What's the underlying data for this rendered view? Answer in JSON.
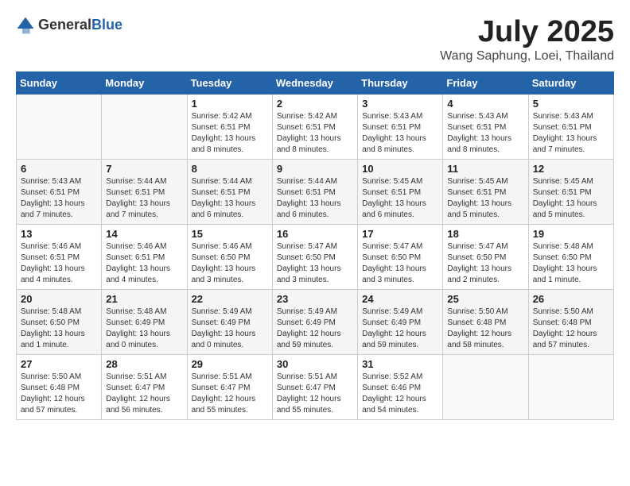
{
  "logo": {
    "general": "General",
    "blue": "Blue"
  },
  "title": "July 2025",
  "location": "Wang Saphung, Loei, Thailand",
  "days_of_week": [
    "Sunday",
    "Monday",
    "Tuesday",
    "Wednesday",
    "Thursday",
    "Friday",
    "Saturday"
  ],
  "weeks": [
    [
      {
        "day": "",
        "info": ""
      },
      {
        "day": "",
        "info": ""
      },
      {
        "day": "1",
        "info": "Sunrise: 5:42 AM\nSunset: 6:51 PM\nDaylight: 13 hours and 8 minutes."
      },
      {
        "day": "2",
        "info": "Sunrise: 5:42 AM\nSunset: 6:51 PM\nDaylight: 13 hours and 8 minutes."
      },
      {
        "day": "3",
        "info": "Sunrise: 5:43 AM\nSunset: 6:51 PM\nDaylight: 13 hours and 8 minutes."
      },
      {
        "day": "4",
        "info": "Sunrise: 5:43 AM\nSunset: 6:51 PM\nDaylight: 13 hours and 8 minutes."
      },
      {
        "day": "5",
        "info": "Sunrise: 5:43 AM\nSunset: 6:51 PM\nDaylight: 13 hours and 7 minutes."
      }
    ],
    [
      {
        "day": "6",
        "info": "Sunrise: 5:43 AM\nSunset: 6:51 PM\nDaylight: 13 hours and 7 minutes."
      },
      {
        "day": "7",
        "info": "Sunrise: 5:44 AM\nSunset: 6:51 PM\nDaylight: 13 hours and 7 minutes."
      },
      {
        "day": "8",
        "info": "Sunrise: 5:44 AM\nSunset: 6:51 PM\nDaylight: 13 hours and 6 minutes."
      },
      {
        "day": "9",
        "info": "Sunrise: 5:44 AM\nSunset: 6:51 PM\nDaylight: 13 hours and 6 minutes."
      },
      {
        "day": "10",
        "info": "Sunrise: 5:45 AM\nSunset: 6:51 PM\nDaylight: 13 hours and 6 minutes."
      },
      {
        "day": "11",
        "info": "Sunrise: 5:45 AM\nSunset: 6:51 PM\nDaylight: 13 hours and 5 minutes."
      },
      {
        "day": "12",
        "info": "Sunrise: 5:45 AM\nSunset: 6:51 PM\nDaylight: 13 hours and 5 minutes."
      }
    ],
    [
      {
        "day": "13",
        "info": "Sunrise: 5:46 AM\nSunset: 6:51 PM\nDaylight: 13 hours and 4 minutes."
      },
      {
        "day": "14",
        "info": "Sunrise: 5:46 AM\nSunset: 6:51 PM\nDaylight: 13 hours and 4 minutes."
      },
      {
        "day": "15",
        "info": "Sunrise: 5:46 AM\nSunset: 6:50 PM\nDaylight: 13 hours and 3 minutes."
      },
      {
        "day": "16",
        "info": "Sunrise: 5:47 AM\nSunset: 6:50 PM\nDaylight: 13 hours and 3 minutes."
      },
      {
        "day": "17",
        "info": "Sunrise: 5:47 AM\nSunset: 6:50 PM\nDaylight: 13 hours and 3 minutes."
      },
      {
        "day": "18",
        "info": "Sunrise: 5:47 AM\nSunset: 6:50 PM\nDaylight: 13 hours and 2 minutes."
      },
      {
        "day": "19",
        "info": "Sunrise: 5:48 AM\nSunset: 6:50 PM\nDaylight: 13 hours and 1 minute."
      }
    ],
    [
      {
        "day": "20",
        "info": "Sunrise: 5:48 AM\nSunset: 6:50 PM\nDaylight: 13 hours and 1 minute."
      },
      {
        "day": "21",
        "info": "Sunrise: 5:48 AM\nSunset: 6:49 PM\nDaylight: 13 hours and 0 minutes."
      },
      {
        "day": "22",
        "info": "Sunrise: 5:49 AM\nSunset: 6:49 PM\nDaylight: 13 hours and 0 minutes."
      },
      {
        "day": "23",
        "info": "Sunrise: 5:49 AM\nSunset: 6:49 PM\nDaylight: 12 hours and 59 minutes."
      },
      {
        "day": "24",
        "info": "Sunrise: 5:49 AM\nSunset: 6:49 PM\nDaylight: 12 hours and 59 minutes."
      },
      {
        "day": "25",
        "info": "Sunrise: 5:50 AM\nSunset: 6:48 PM\nDaylight: 12 hours and 58 minutes."
      },
      {
        "day": "26",
        "info": "Sunrise: 5:50 AM\nSunset: 6:48 PM\nDaylight: 12 hours and 57 minutes."
      }
    ],
    [
      {
        "day": "27",
        "info": "Sunrise: 5:50 AM\nSunset: 6:48 PM\nDaylight: 12 hours and 57 minutes."
      },
      {
        "day": "28",
        "info": "Sunrise: 5:51 AM\nSunset: 6:47 PM\nDaylight: 12 hours and 56 minutes."
      },
      {
        "day": "29",
        "info": "Sunrise: 5:51 AM\nSunset: 6:47 PM\nDaylight: 12 hours and 55 minutes."
      },
      {
        "day": "30",
        "info": "Sunrise: 5:51 AM\nSunset: 6:47 PM\nDaylight: 12 hours and 55 minutes."
      },
      {
        "day": "31",
        "info": "Sunrise: 5:52 AM\nSunset: 6:46 PM\nDaylight: 12 hours and 54 minutes."
      },
      {
        "day": "",
        "info": ""
      },
      {
        "day": "",
        "info": ""
      }
    ]
  ]
}
